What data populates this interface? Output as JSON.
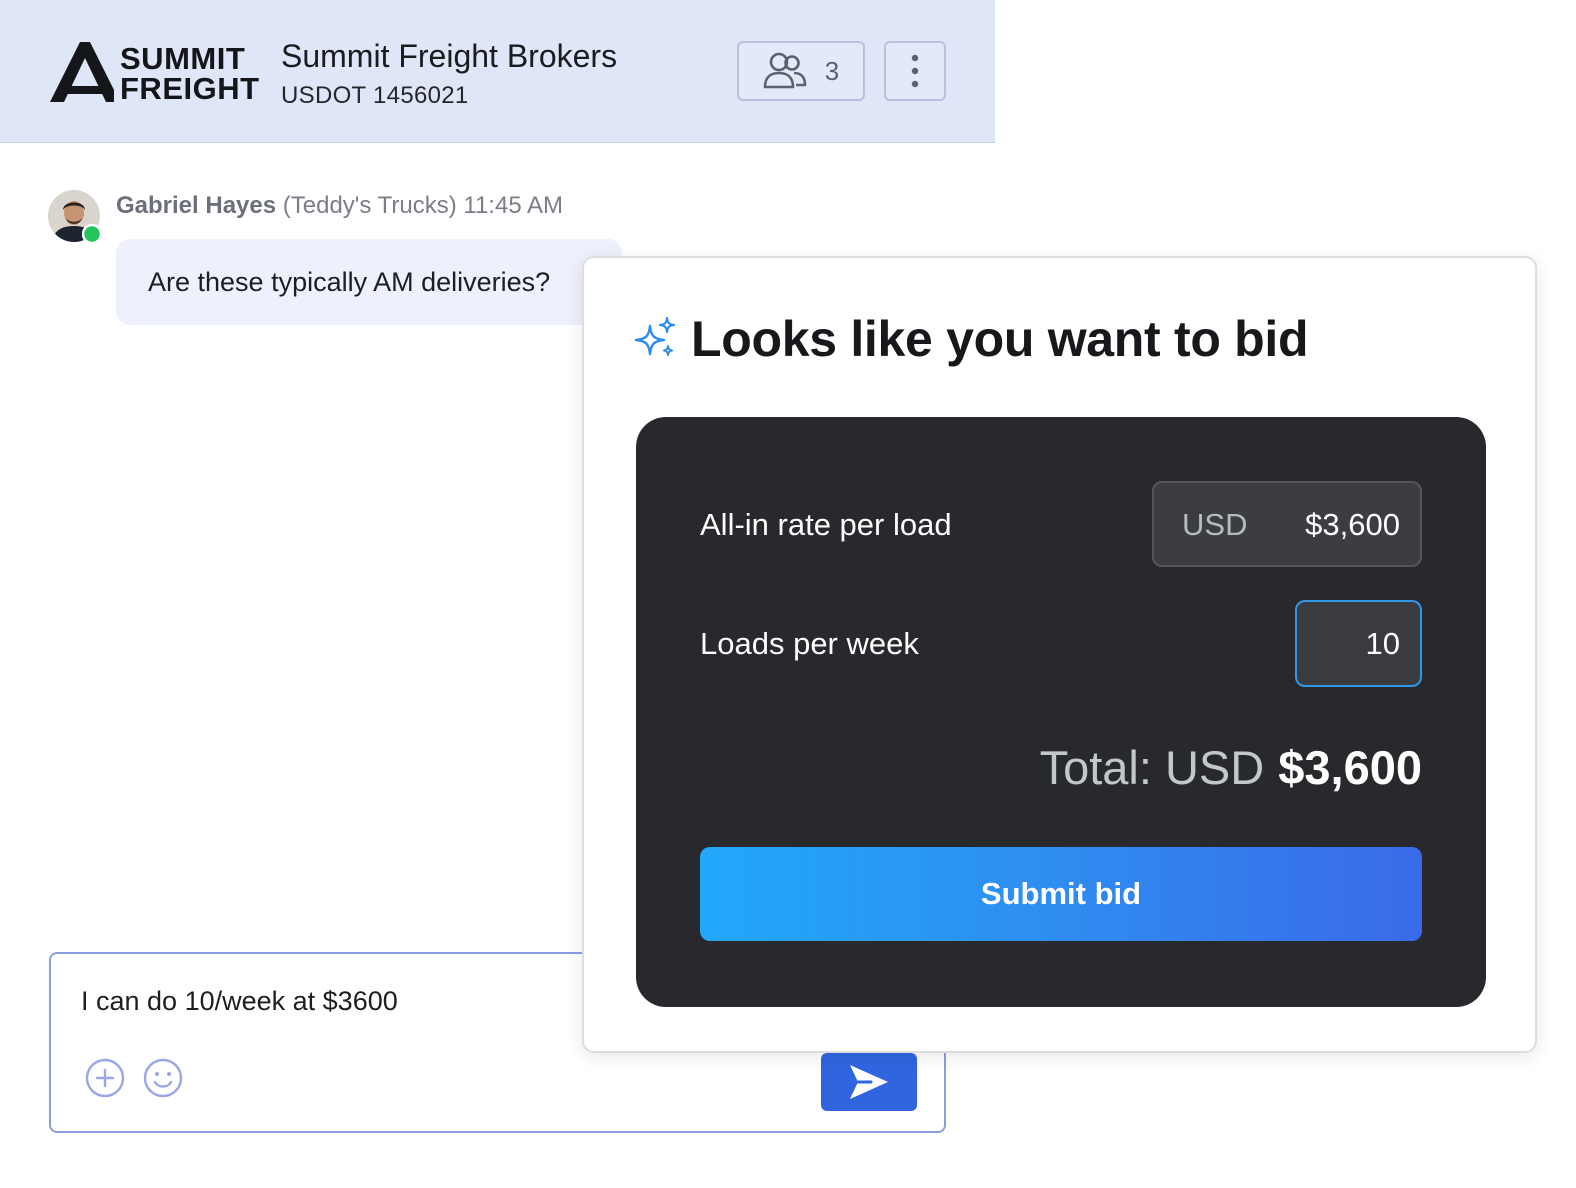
{
  "header": {
    "logo_line1": "SUMMIT",
    "logo_line2": "FREIGHT",
    "company_name": "Summit Freight Brokers",
    "usdot": "USDOT 1456021",
    "members_count": "3",
    "members_icon": "users-icon",
    "more_icon": "more-vertical-icon"
  },
  "message": {
    "author": "Gabriel Hayes",
    "company": "(Teddy's Trucks)",
    "time": "11:45 AM",
    "text": "Are these typically AM deliveries?",
    "online": true
  },
  "composer": {
    "text": "I can do 10/week at $3600",
    "add_icon": "plus-circle-icon",
    "emoji_icon": "smiley-icon",
    "send_icon": "send-icon"
  },
  "bid_popup": {
    "title": "Looks like you want to bid",
    "title_icon": "sparkles-icon",
    "rate_label": "All-in rate per load",
    "rate_currency": "USD",
    "rate_value": "$3,600",
    "loads_label": "Loads per week",
    "loads_value": "10",
    "total_label": "Total: USD",
    "total_value": "$3,600",
    "submit_label": "Submit bid"
  },
  "colors": {
    "header_bg": "#dfe6f7",
    "card_bg": "#28292d",
    "accent_start": "#21a8fb",
    "accent_end": "#3a6ae8",
    "send_button": "#3165e0",
    "online_dot": "#22c55e"
  }
}
